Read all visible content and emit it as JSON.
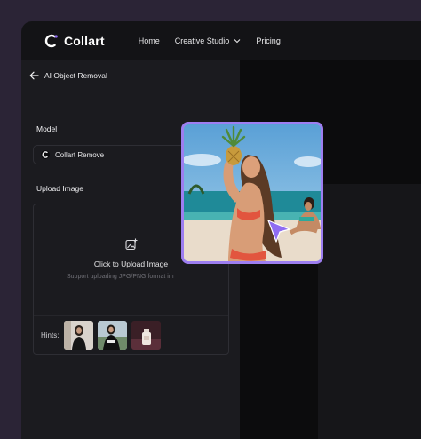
{
  "brand": {
    "name": "Collart",
    "accent": "#8f6cf2"
  },
  "nav": {
    "items": [
      {
        "label": "Home"
      },
      {
        "label": "Creative Studio",
        "has_dropdown": true
      },
      {
        "label": "Pricing"
      }
    ]
  },
  "sidebar": {
    "back_title": "AI Object Removal",
    "model_label": "Model",
    "model_value": "Collart Remove",
    "upload_label": "Upload Image",
    "upload_title": "Click to Upload Image",
    "upload_subtitle": "Support uploading JPG/PNG format im",
    "hints_label": "Hints:"
  },
  "icons": {
    "back": "arrow-left-icon",
    "chevron": "chevron-down-icon",
    "upload": "image-add-icon",
    "cursor": "pointer-cursor-icon"
  },
  "colors": {
    "preview_border": "#9d7ef0",
    "cursor": "#8f6cf2"
  }
}
